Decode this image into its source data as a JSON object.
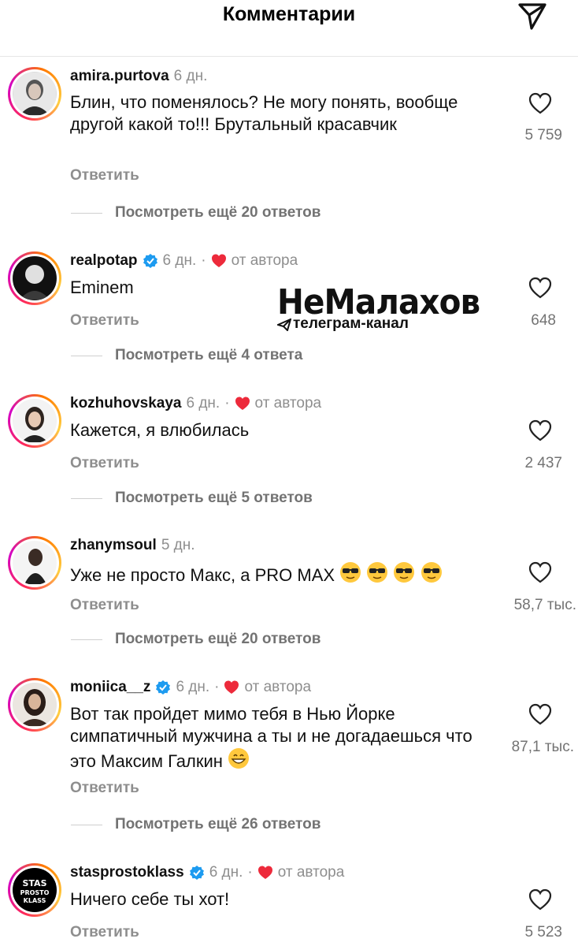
{
  "header": {
    "title": "Комментарии",
    "send_icon": "send-icon"
  },
  "comments": [
    {
      "username": "amira.purtova",
      "time": "6 дн.",
      "verified": false,
      "author_liked": false,
      "text": "Блин, что поменялось? Не могу понять, вообще другой какой то!!! Брутальный красавчик",
      "reply_label": "Ответить",
      "likes": "5 759",
      "more_replies": "Посмотреть ещё 20 ответов"
    },
    {
      "username": "realpotap",
      "time": "6 дн.",
      "verified": true,
      "author_liked": true,
      "author_label": "от автора",
      "text": "Eminem",
      "reply_label": "Ответить",
      "likes": "648",
      "more_replies": "Посмотреть ещё 4 ответа"
    },
    {
      "username": "kozhuhovskaya",
      "time": "6 дн.",
      "verified": false,
      "author_liked": true,
      "author_label": "от автора",
      "text": "Кажется, я влюбилась",
      "reply_label": "Ответить",
      "likes": "2 437",
      "more_replies": "Посмотреть ещё 5 ответов"
    },
    {
      "username": "zhanymsoul",
      "time": "5 дн.",
      "verified": false,
      "author_liked": false,
      "text": "Уже не просто Макс, а PRO MAX",
      "emoji": "sunglasses-emoji x4",
      "reply_label": "Ответить",
      "likes": "58,7 тыс.",
      "more_replies": "Посмотреть ещё 20 ответов"
    },
    {
      "username": "moniica__z",
      "time": "6 дн.",
      "verified": true,
      "author_liked": true,
      "author_label": "от автора",
      "text": "Вот так пройдет мимо тебя в Нью Йорке симпатичный мужчина а ты и не догадаешься что это Максим Галкин",
      "emoji": "grin-emoji",
      "reply_label": "Ответить",
      "likes": "87,1 тыс.",
      "more_replies": "Посмотреть ещё 26 ответов"
    },
    {
      "username": "stasprostoklass",
      "time": "6 дн.",
      "verified": true,
      "author_liked": true,
      "author_label": "от автора",
      "text": "Ничего себе ты хот!",
      "reply_label": "Ответить",
      "likes": "5 523",
      "avatar_text": "STAS PROSTO KLASS"
    }
  ],
  "watermark": {
    "title": "НеМалахов",
    "subtitle": "телеграм-канал"
  },
  "colors": {
    "heart_red": "#ed2a3b",
    "verified_blue": "#1d9bf0",
    "muted": "#8e8e8e"
  }
}
